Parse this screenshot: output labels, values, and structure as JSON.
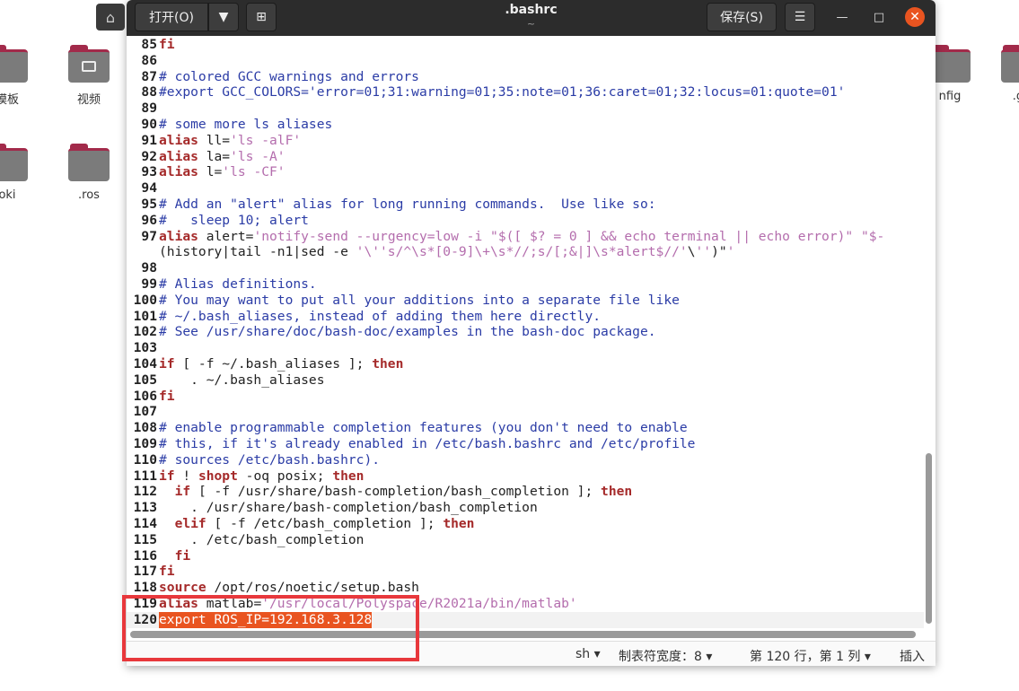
{
  "desktop": {
    "folders": [
      {
        "label": "模板"
      },
      {
        "label": "视频"
      },
      {
        "label": "oki"
      },
      {
        "label": ".ros"
      },
      {
        "label": "nfig"
      },
      {
        "label": ".gn"
      }
    ]
  },
  "window": {
    "title": ".bashrc",
    "subtitle": "~",
    "open_label": "打开(O)",
    "save_label": "保存(S)"
  },
  "code_lines": [
    {
      "n": "85",
      "t": "fi"
    },
    {
      "n": "86",
      "t": ""
    },
    {
      "n": "87",
      "t": "# colored GCC warnings and errors"
    },
    {
      "n": "88",
      "t": "#export GCC_COLORS='error=01;31:warning=01;35:note=01;36:caret=01;32:locus=01:quote=01'"
    },
    {
      "n": "89",
      "t": ""
    },
    {
      "n": "90",
      "t": "# some more ls aliases"
    },
    {
      "n": "91",
      "t": "alias ll='ls -alF'"
    },
    {
      "n": "92",
      "t": "alias la='ls -A'"
    },
    {
      "n": "93",
      "t": "alias l='ls -CF'"
    },
    {
      "n": "94",
      "t": ""
    },
    {
      "n": "95",
      "t": "# Add an \"alert\" alias for long running commands.  Use like so:"
    },
    {
      "n": "96",
      "t": "#   sleep 10; alert"
    },
    {
      "n": "97",
      "t": "alias alert='notify-send --urgency=low -i \"$([ $? = 0 ] && echo terminal || echo error)\" \"$-"
    },
    {
      "n": "",
      "t": "(history|tail -n1|sed -e '\\''s/^\\s*[0-9]\\+\\s*//;s/[;&|]\\s*alert$//'\\'')\"'"
    },
    {
      "n": "98",
      "t": ""
    },
    {
      "n": "99",
      "t": "# Alias definitions."
    },
    {
      "n": "100",
      "t": "# You may want to put all your additions into a separate file like"
    },
    {
      "n": "101",
      "t": "# ~/.bash_aliases, instead of adding them here directly."
    },
    {
      "n": "102",
      "t": "# See /usr/share/doc/bash-doc/examples in the bash-doc package."
    },
    {
      "n": "103",
      "t": ""
    },
    {
      "n": "104",
      "t": "if [ -f ~/.bash_aliases ]; then"
    },
    {
      "n": "105",
      "t": "    . ~/.bash_aliases"
    },
    {
      "n": "106",
      "t": "fi"
    },
    {
      "n": "107",
      "t": ""
    },
    {
      "n": "108",
      "t": "# enable programmable completion features (you don't need to enable"
    },
    {
      "n": "109",
      "t": "# this, if it's already enabled in /etc/bash.bashrc and /etc/profile"
    },
    {
      "n": "110",
      "t": "# sources /etc/bash.bashrc)."
    },
    {
      "n": "111",
      "t": "if ! shopt -oq posix; then"
    },
    {
      "n": "112",
      "t": "  if [ -f /usr/share/bash-completion/bash_completion ]; then"
    },
    {
      "n": "113",
      "t": "    . /usr/share/bash-completion/bash_completion"
    },
    {
      "n": "114",
      "t": "  elif [ -f /etc/bash_completion ]; then"
    },
    {
      "n": "115",
      "t": "    . /etc/bash_completion"
    },
    {
      "n": "116",
      "t": "  fi"
    },
    {
      "n": "117",
      "t": "fi"
    },
    {
      "n": "118",
      "t": "source /opt/ros/noetic/setup.bash"
    },
    {
      "n": "119",
      "t": "alias matlab='/usr/local/Polyspace/R2021a/bin/matlab'"
    },
    {
      "n": "120",
      "t": "export ROS_IP=192.168.3.128"
    }
  ],
  "status": {
    "language": "sh ▾",
    "tab_width": "制表符宽度：8 ▾",
    "position": "第 120 行，第 1 列 ▾",
    "mode": "插入"
  },
  "colors": {
    "accent": "#e95420",
    "highlight_box": "#e8383c"
  }
}
